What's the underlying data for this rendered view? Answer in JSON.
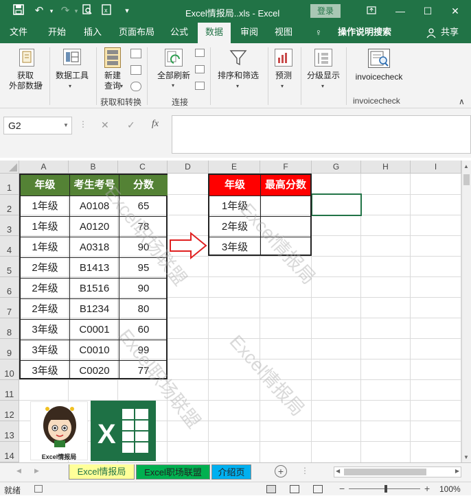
{
  "titlebar": {
    "title": "Excel情报局..xls  -  Excel",
    "login": "登录"
  },
  "tabs": [
    "文件",
    "开始",
    "插入",
    "页面布局",
    "公式",
    "数据",
    "审阅",
    "视图",
    "操作说明搜索",
    "共享"
  ],
  "ribbon": {
    "get_data": "获取\n外部数据",
    "data_tools": "数据工具",
    "new_query": "新建\n查询",
    "group1": "获取和转换",
    "refresh_all": "全部刷新",
    "group2": "连接",
    "sort_filter": "排序和筛选",
    "forecast": "预测",
    "outline": "分级显示",
    "invoicecheck": "invoicecheck",
    "invoicecheck_group": "invoicecheck"
  },
  "formula_bar": {
    "name_box": "G2",
    "fx": "fx",
    "cancel": "✕",
    "enter": "✓",
    "value": ""
  },
  "columns": [
    "A",
    "B",
    "C",
    "D",
    "E",
    "F",
    "G",
    "H",
    "I"
  ],
  "rows": [
    "1",
    "2",
    "3",
    "4",
    "5",
    "6",
    "7",
    "8",
    "9",
    "10",
    "11",
    "12",
    "13",
    "14"
  ],
  "table1": {
    "headers": [
      "年级",
      "考生考号",
      "分数"
    ],
    "rows": [
      [
        "1年级",
        "A0108",
        "65"
      ],
      [
        "1年级",
        "A0120",
        "78"
      ],
      [
        "1年级",
        "A0318",
        "90"
      ],
      [
        "2年级",
        "B1413",
        "95"
      ],
      [
        "2年级",
        "B1516",
        "90"
      ],
      [
        "2年级",
        "B1234",
        "80"
      ],
      [
        "3年级",
        "C0001",
        "60"
      ],
      [
        "3年级",
        "C0010",
        "99"
      ],
      [
        "3年级",
        "C0020",
        "77"
      ]
    ]
  },
  "table2": {
    "headers": [
      "年级",
      "最高分数"
    ],
    "rows": [
      [
        "1年级",
        ""
      ],
      [
        "2年级",
        ""
      ],
      [
        "3年级",
        ""
      ]
    ]
  },
  "watermarks": [
    "Excel职场联盟",
    "Excel情报局",
    "Excel职场联盟",
    "Excel情报局"
  ],
  "logo_caption": "Excel情报局",
  "sheets": [
    "Excel情报局",
    "Excel职场联盟",
    "介绍页"
  ],
  "status": {
    "left": "就绪",
    "zoom": "100%"
  },
  "colors": {
    "excel_green": "#217346",
    "header_green": "#548235",
    "header_red": "#ff0000",
    "tab_yellow": "#ffff99",
    "tab_green": "#00b050",
    "tab_blue": "#00b0f0"
  }
}
